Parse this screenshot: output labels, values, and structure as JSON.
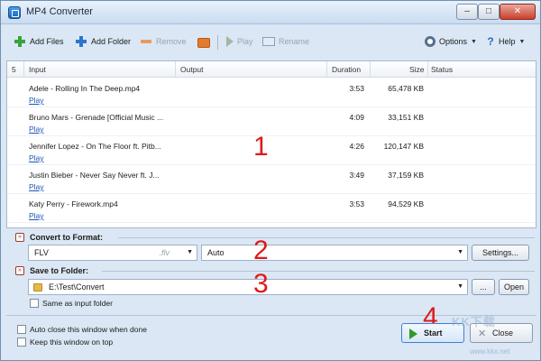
{
  "window": {
    "title": "MP4 Converter",
    "minimize": "–",
    "maximize": "□",
    "close": "✕"
  },
  "toolbar": {
    "add_files": "Add Files",
    "add_folder": "Add Folder",
    "remove": "Remove",
    "play": "Play",
    "rename": "Rename",
    "options": "Options",
    "help": "Help"
  },
  "list": {
    "count": "5",
    "columns": {
      "input": "Input",
      "output": "Output",
      "duration": "Duration",
      "size": "Size",
      "status": "Status"
    },
    "rows": [
      {
        "name": "Adele - Rolling In The Deep.mp4",
        "play": "Play",
        "duration": "3:53",
        "size": "65,478 KB"
      },
      {
        "name": "Bruno Mars - Grenade [Official Music ...",
        "play": "Play",
        "duration": "4:09",
        "size": "33,151 KB"
      },
      {
        "name": "Jennifer Lopez - On The Floor ft. Pitb...",
        "play": "Play",
        "duration": "4:26",
        "size": "120,147 KB"
      },
      {
        "name": "Justin Bieber - Never Say Never ft. J...",
        "play": "Play",
        "duration": "3:49",
        "size": "37,159 KB"
      },
      {
        "name": "Katy Perry - Firework.mp4",
        "play": "Play",
        "duration": "3:53",
        "size": "94,529 KB"
      }
    ]
  },
  "callouts": {
    "one": "1",
    "two": "2",
    "three": "3",
    "four": "4"
  },
  "convert": {
    "title": "Convert to Format:",
    "toggle": "»",
    "format": "FLV",
    "format_ext": ".flv",
    "preset": "Auto",
    "settings": "Settings..."
  },
  "save": {
    "title": "Save to Folder:",
    "toggle": "»",
    "path": "E:\\Test\\Convert",
    "browse": "...",
    "open": "Open",
    "same_as_input": "Same as input folder"
  },
  "bottom": {
    "auto_close": "Auto close this window when done",
    "keep_on_top": "Keep this window on top",
    "start": "Start",
    "close": "Close"
  },
  "watermark": {
    "logo": "KK下载",
    "url": "www.kkx.net"
  },
  "colors": {
    "accent": "#2f76c9",
    "callout": "#e01919",
    "play_link": "#1d55b6"
  }
}
